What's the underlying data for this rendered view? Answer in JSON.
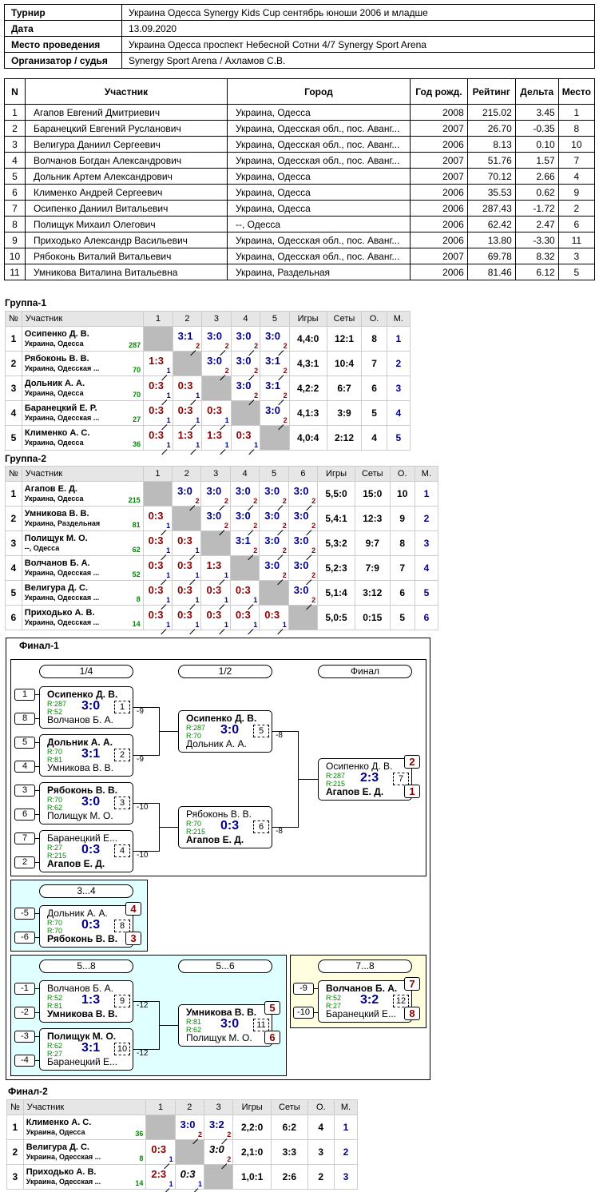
{
  "info": {
    "tournament_k": "Турнир",
    "tournament": "Украина Одесса Synergy Kids Cup сентябрь юноши 2006 и младше",
    "date_k": "Дата",
    "date": "13.09.2020",
    "place_k": "Место проведения",
    "place": "Украина Одесса проспект Небесной Сотни 4/7 Synergy Sport Arena",
    "org_k": "Организатор / судья",
    "org": "Synergy Sport Arena / Ахламов С.В."
  },
  "participants": {
    "headers": [
      "N",
      "Участник",
      "Город",
      "Год рожд.",
      "Рейтинг",
      "Дельта",
      "Место"
    ],
    "rows": [
      [
        "1",
        "Агапов Евгений Дмитриевич",
        "Украина, Одесса",
        "2008",
        "215.02",
        "3.45",
        "1"
      ],
      [
        "2",
        "Баранецкий Евгений Русланович",
        "Украина, Одесская обл., пос. Аванг...",
        "2007",
        "26.70",
        "-0.35",
        "8"
      ],
      [
        "3",
        "Велигура Даниил Сергеевич",
        "Украина, Одесская обл., пос. Аванг...",
        "2006",
        "8.13",
        "0.10",
        "10"
      ],
      [
        "4",
        "Волчанов Богдан Александрович",
        "Украина, Одесская обл., пос. Аванг...",
        "2007",
        "51.76",
        "1.57",
        "7"
      ],
      [
        "5",
        "Дольник Артем Александрович",
        "Украина, Одесса",
        "2007",
        "70.12",
        "2.66",
        "4"
      ],
      [
        "6",
        "Клименко Андрей Сергеевич",
        "Украина, Одесса",
        "2006",
        "35.53",
        "0.62",
        "9"
      ],
      [
        "7",
        "Осипенко Даниил Витальевич",
        "Украина, Одесса",
        "2006",
        "287.43",
        "-1.72",
        "2"
      ],
      [
        "8",
        "Полищук Михаил Олегович",
        "--, Одесса",
        "2006",
        "62.42",
        "2.47",
        "6"
      ],
      [
        "9",
        "Приходько Александр Васильевич",
        "Украина, Одесская обл., пос. Аванг...",
        "2006",
        "13.80",
        "-3.30",
        "11"
      ],
      [
        "10",
        "Рябоконь Виталий Витальевич",
        "Украина, Одесская обл., пос. Аванг...",
        "2007",
        "69.78",
        "8.32",
        "3"
      ],
      [
        "11",
        "Умникова Виталина Витальевна",
        "Украина, Раздельная",
        "2006",
        "81.46",
        "6.12",
        "5"
      ]
    ]
  },
  "group_headers": {
    "num": "№",
    "name": "Участник",
    "games": "Игры",
    "sets": "Сеты",
    "pts": "О.",
    "place": "М."
  },
  "group1": {
    "title": "Группа-1",
    "cols": [
      "1",
      "2",
      "3",
      "4",
      "5"
    ],
    "rows": [
      {
        "n": "1",
        "name": "Осипенко Д. В.",
        "city": "Украина, Одесса",
        "rating": "287",
        "cells": [
          "X",
          "3:1/2w",
          "3:0/2w",
          "3:0/2w",
          "3:0/2w"
        ],
        "games": "4,4:0",
        "sets": "12:1",
        "pts": "8",
        "place": "1"
      },
      {
        "n": "2",
        "name": "Рябоконь В. В.",
        "city": "Украина, Одесская ...",
        "rating": "70",
        "cells": [
          "1:3/1l",
          "X",
          "3:0/2w",
          "3:0/2w",
          "3:1/2w"
        ],
        "games": "4,3:1",
        "sets": "10:4",
        "pts": "7",
        "place": "2"
      },
      {
        "n": "3",
        "name": "Дольник А. А.",
        "city": "Украина, Одесса",
        "rating": "70",
        "cells": [
          "0:3/1l",
          "0:3/1l",
          "X",
          "3:0/2w",
          "3:1/2w"
        ],
        "games": "4,2:2",
        "sets": "6:7",
        "pts": "6",
        "place": "3"
      },
      {
        "n": "4",
        "name": "Баранецкий Е. Р.",
        "city": "Украина, Одесская ...",
        "rating": "27",
        "cells": [
          "0:3/1l",
          "0:3/1l",
          "0:3/1l",
          "X",
          "3:0/2w"
        ],
        "games": "4,1:3",
        "sets": "3:9",
        "pts": "5",
        "place": "4"
      },
      {
        "n": "5",
        "name": "Клименко А. С.",
        "city": "Украина, Одесса",
        "rating": "36",
        "cells": [
          "0:3/1l",
          "1:3/1l",
          "1:3/1l",
          "0:3/1l",
          "X"
        ],
        "games": "4,0:4",
        "sets": "2:12",
        "pts": "4",
        "place": "5"
      }
    ]
  },
  "group2": {
    "title": "Группа-2",
    "cols": [
      "1",
      "2",
      "3",
      "4",
      "5",
      "6"
    ],
    "rows": [
      {
        "n": "1",
        "name": "Агапов Е. Д.",
        "city": "Украина, Одесса",
        "rating": "215",
        "cells": [
          "X",
          "3:0/2w",
          "3:0/2w",
          "3:0/2w",
          "3:0/2w",
          "3:0/2w"
        ],
        "games": "5,5:0",
        "sets": "15:0",
        "pts": "10",
        "place": "1"
      },
      {
        "n": "2",
        "name": "Умникова В. В.",
        "city": "Украина, Раздельная",
        "rating": "81",
        "cells": [
          "0:3/1l",
          "X",
          "3:0/2w",
          "3:0/2w",
          "3:0/2w",
          "3:0/2w"
        ],
        "games": "5,4:1",
        "sets": "12:3",
        "pts": "9",
        "place": "2"
      },
      {
        "n": "3",
        "name": "Полищук М. О.",
        "city": "--, Одесса",
        "rating": "62",
        "cells": [
          "0:3/1l",
          "0:3/1l",
          "X",
          "3:1/2w",
          "3:0/2w",
          "3:0/2w"
        ],
        "games": "5,3:2",
        "sets": "9:7",
        "pts": "8",
        "place": "3"
      },
      {
        "n": "4",
        "name": "Волчанов Б. А.",
        "city": "Украина, Одесская ...",
        "rating": "52",
        "cells": [
          "0:3/1l",
          "0:3/1l",
          "1:3/1l",
          "X",
          "3:0/2w",
          "3:0/2w"
        ],
        "games": "5,2:3",
        "sets": "7:9",
        "pts": "7",
        "place": "4"
      },
      {
        "n": "5",
        "name": "Велигура Д. С.",
        "city": "Украина, Одесская ...",
        "rating": "8",
        "cells": [
          "0:3/1l",
          "0:3/1l",
          "0:3/1l",
          "0:3/1l",
          "X",
          "3:0/2w"
        ],
        "games": "5,1:4",
        "sets": "3:12",
        "pts": "6",
        "place": "5"
      },
      {
        "n": "6",
        "name": "Приходько А. В.",
        "city": "Украина, Одесская ...",
        "rating": "14",
        "cells": [
          "0:3/1l",
          "0:3/1l",
          "0:3/1l",
          "0:3/1l",
          "0:3/1l",
          "X"
        ],
        "games": "5,0:5",
        "sets": "0:15",
        "pts": "5",
        "place": "6"
      }
    ]
  },
  "final1": {
    "title": "Финал-1",
    "rounds": [
      "1/4",
      "1/2",
      "Финал"
    ],
    "third": "3...4",
    "fifth": "5...8",
    "fifth6": "5...6",
    "seventh": "7...8",
    "matches": [
      {
        "id": "m1",
        "p1": "Осипенко Д. В.",
        "r1": "R:287",
        "p2": "Волчанов Б. А.",
        "r2": "R:52",
        "score": "3:0",
        "num": "1",
        "win": 1,
        "s1": "1",
        "s2": "8",
        "out": "-9"
      },
      {
        "id": "m2",
        "p1": "Дольник А. А.",
        "r1": "R:70",
        "p2": "Умникова В. В.",
        "r2": "R:81",
        "score": "3:1",
        "num": "2",
        "win": 1,
        "s1": "5",
        "s2": "4",
        "out": "-9"
      },
      {
        "id": "m3",
        "p1": "Рябоконь В. В.",
        "r1": "R:70",
        "p2": "Полищук М. О.",
        "r2": "R:62",
        "score": "3:0",
        "num": "3",
        "win": 1,
        "s1": "3",
        "s2": "6",
        "out": "-10"
      },
      {
        "id": "m4",
        "p1": "Баранецкий Е...",
        "r1": "R:27",
        "p2": "Агапов Е. Д.",
        "r2": "R:215",
        "score": "0:3",
        "num": "4",
        "win": 2,
        "s1": "7",
        "s2": "2",
        "out": "-10"
      },
      {
        "id": "m5",
        "p1": "Осипенко Д. В.",
        "r1": "R:287",
        "p2": "Дольник А. А.",
        "r2": "R:70",
        "score": "3:0",
        "num": "5",
        "win": 1,
        "out": "-8"
      },
      {
        "id": "m6",
        "p1": "Рябоконь В. В.",
        "r1": "R:70",
        "p2": "Агапов Е. Д.",
        "r2": "R:215",
        "score": "0:3",
        "num": "6",
        "win": 2,
        "out": "-8"
      },
      {
        "id": "m7",
        "p1": "Осипенко Д. В.",
        "r1": "R:287",
        "p2": "Агапов Е. Д.",
        "r2": "R:215",
        "score": "2:3",
        "num": "7",
        "win": 2,
        "pl1": "2",
        "pl2": "1"
      },
      {
        "id": "m8",
        "p1": "Дольник А. А.",
        "r1": "R:70",
        "p2": "Рябоконь В. В.",
        "r2": "R:70",
        "score": "0:3",
        "num": "8",
        "win": 2,
        "s1": "-5",
        "s2": "-6",
        "pl1": "4",
        "pl2": "3"
      },
      {
        "id": "m9",
        "p1": "Волчанов Б. А.",
        "r1": "R:52",
        "p2": "Умникова В. В.",
        "r2": "R:81",
        "score": "1:3",
        "num": "9",
        "win": 2,
        "s1": "-1",
        "s2": "-2",
        "out": "-12"
      },
      {
        "id": "m10",
        "p1": "Полищук М. О.",
        "r1": "R:62",
        "p2": "Баранецкий Е...",
        "r2": "R:27",
        "score": "3:1",
        "num": "10",
        "win": 1,
        "s1": "-3",
        "s2": "-4",
        "out": "-12"
      },
      {
        "id": "m11",
        "p1": "Умникова В. В.",
        "r1": "R:81",
        "p2": "Полищук М. О.",
        "r2": "R:62",
        "score": "3:0",
        "num": "11",
        "win": 1,
        "pl1": "5",
        "pl2": "6"
      },
      {
        "id": "m12",
        "p1": "Волчанов Б. А.",
        "r1": "R:52",
        "p2": "Баранецкий Е...",
        "r2": "R:27",
        "score": "3:2",
        "num": "12",
        "win": 1,
        "s1": "-9",
        "s2": "-10",
        "pl1": "7",
        "pl2": "8"
      }
    ]
  },
  "final2": {
    "title": "Финал-2",
    "cols": [
      "1",
      "2",
      "3"
    ],
    "rows": [
      {
        "n": "1",
        "name": "Клименко А. С.",
        "city": "Украина, Одесса",
        "rating": "36",
        "cells": [
          "X",
          "3:0/2w",
          "3:2/2w"
        ],
        "games": "2,2:0",
        "sets": "6:2",
        "pts": "4",
        "place": "1"
      },
      {
        "n": "2",
        "name": "Велигура Д. С.",
        "city": "Украина, Одесская ...",
        "rating": "8",
        "cells": [
          "0:3/1l",
          "X",
          "3:0/2n"
        ],
        "games": "2,1:0",
        "sets": "3:3",
        "pts": "3",
        "place": "2"
      },
      {
        "n": "3",
        "name": "Приходько А. В.",
        "city": "Украина, Одесская ...",
        "rating": "14",
        "cells": [
          "2:3/1l",
          "0:3/1n",
          "X"
        ],
        "games": "1,0:1",
        "sets": "2:6",
        "pts": "2",
        "place": "3"
      }
    ]
  }
}
